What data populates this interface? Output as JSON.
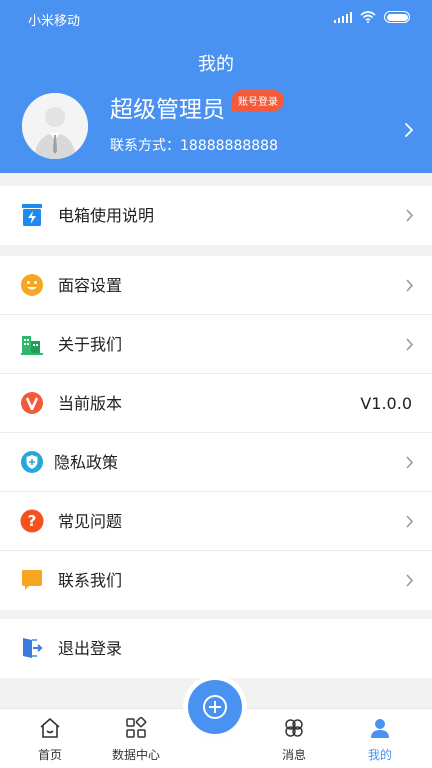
{
  "status_bar": {
    "carrier": "小米移动"
  },
  "header": {
    "title": "我的",
    "user_name": "超级管理员",
    "login_badge": "账号登录",
    "contact_label": "联系方式：",
    "contact_value": "18888888888"
  },
  "menu_sections": [
    {
      "items": [
        {
          "label": "电箱使用说明",
          "icon": "electric-box-icon",
          "color": "#1e8af0"
        }
      ]
    },
    {
      "items": [
        {
          "label": "面容设置",
          "icon": "face-icon",
          "color": "#f5a623"
        },
        {
          "label": "关于我们",
          "icon": "buildings-icon",
          "color": "#2fb86b"
        },
        {
          "label": "当前版本",
          "icon": "version-icon",
          "value": "V1.0.0",
          "color": "#f25a3a"
        },
        {
          "label": "隐私政策",
          "icon": "shield-icon",
          "color": "#27a7d9"
        },
        {
          "label": "常见问题",
          "icon": "question-icon",
          "color": "#f5511e"
        },
        {
          "label": "联系我们",
          "icon": "chat-icon",
          "color": "#f5a623"
        }
      ]
    },
    {
      "items": [
        {
          "label": "退出登录",
          "icon": "logout-icon",
          "color": "#3b7be0"
        }
      ]
    }
  ],
  "tabbar": {
    "tabs": [
      {
        "label": "首页",
        "icon": "home-icon"
      },
      {
        "label": "数据中心",
        "icon": "grid-icon"
      },
      {
        "label": "消息",
        "icon": "clover-icon"
      },
      {
        "label": "我的",
        "icon": "person-icon",
        "active": true
      }
    ],
    "center_button": "add-icon"
  },
  "colors": {
    "primary": "#4a92f1",
    "badge": "#f25a3a"
  }
}
